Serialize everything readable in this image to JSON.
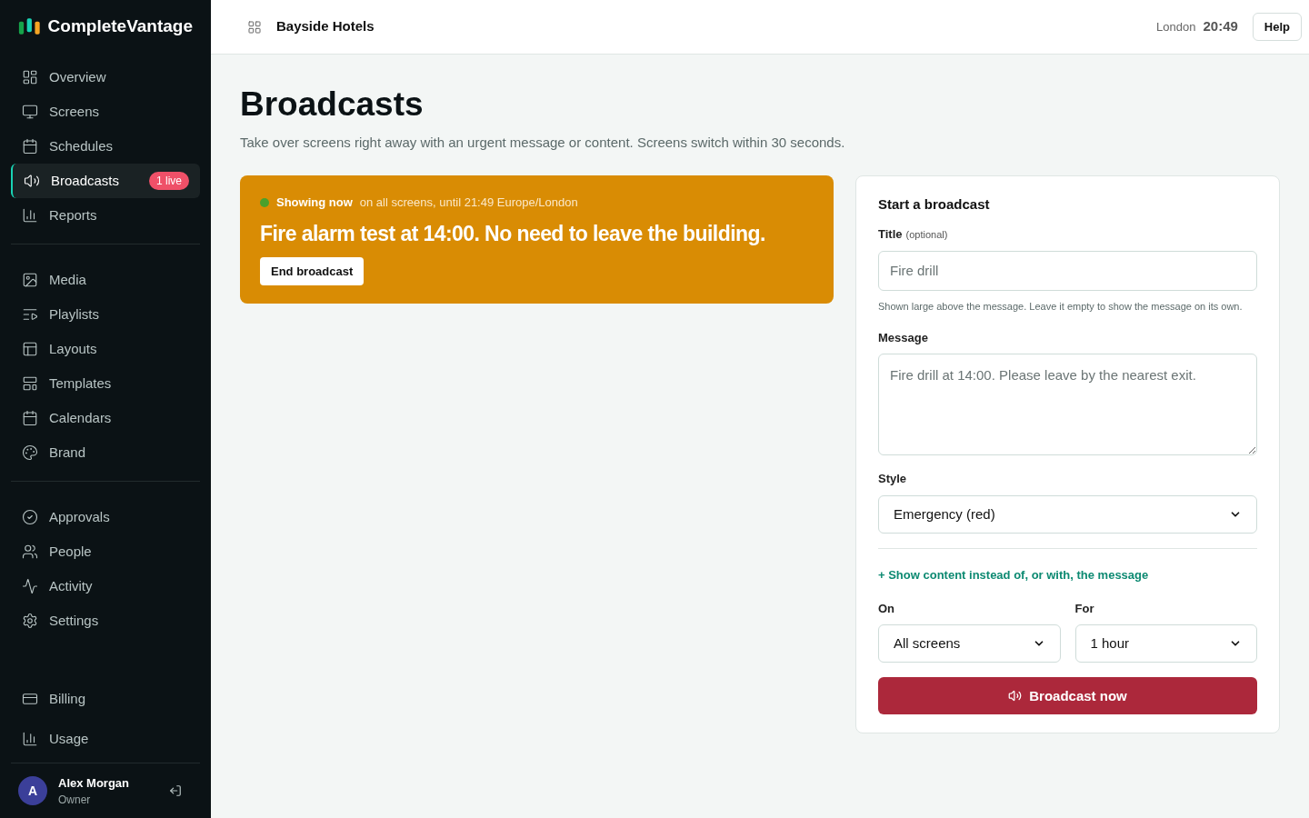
{
  "brand": "CompleteVantage",
  "sidebar": {
    "groups": [
      [
        {
          "label": "Overview",
          "selected": false
        },
        {
          "label": "Screens",
          "selected": false
        },
        {
          "label": "Schedules",
          "selected": false
        },
        {
          "label": "Broadcasts",
          "selected": true,
          "badge": "1 live"
        },
        {
          "label": "Reports",
          "selected": false
        }
      ],
      [
        {
          "label": "Media",
          "selected": false
        },
        {
          "label": "Playlists",
          "selected": false
        },
        {
          "label": "Layouts",
          "selected": false
        },
        {
          "label": "Templates",
          "selected": false
        },
        {
          "label": "Calendars",
          "selected": false
        },
        {
          "label": "Brand",
          "selected": false
        }
      ],
      [
        {
          "label": "Approvals",
          "selected": false
        },
        {
          "label": "People",
          "selected": false
        },
        {
          "label": "Activity",
          "selected": false
        },
        {
          "label": "Settings",
          "selected": false
        }
      ]
    ],
    "bottom": [
      {
        "label": "Billing",
        "selected": false
      },
      {
        "label": "Usage",
        "selected": false
      }
    ],
    "user": {
      "initial": "A",
      "name": "Alex Morgan",
      "role": "Owner"
    }
  },
  "topbar": {
    "org": "Bayside Hotels",
    "city": "London",
    "time": "20:49",
    "help": "Help"
  },
  "page": {
    "title": "Broadcasts",
    "subtitle": "Take over screens right away with an urgent message or content. Screens switch within 30 seconds."
  },
  "live": {
    "status": "Showing now",
    "detail": "on all screens, until 21:49 Europe/London",
    "message": "Fire alarm test at 14:00. No need to leave the building.",
    "button": "End broadcast"
  },
  "form": {
    "heading": "Start a broadcast",
    "title_label": "Title",
    "title_hint": "(optional)",
    "title_placeholder": "Fire drill",
    "title_help": "Shown large above the message. Leave it empty to show the message on its own.",
    "message_label": "Message",
    "message_placeholder": "Fire drill at 14:00. Please leave by the nearest exit.",
    "style_label": "Style",
    "style_value": "Emergency (red)",
    "more_link": "+ Show content instead of, or with, the message",
    "on_label": "On",
    "on_value": "All screens",
    "for_label": "For",
    "for_value": "1 hour",
    "submit": "Broadcast now"
  }
}
